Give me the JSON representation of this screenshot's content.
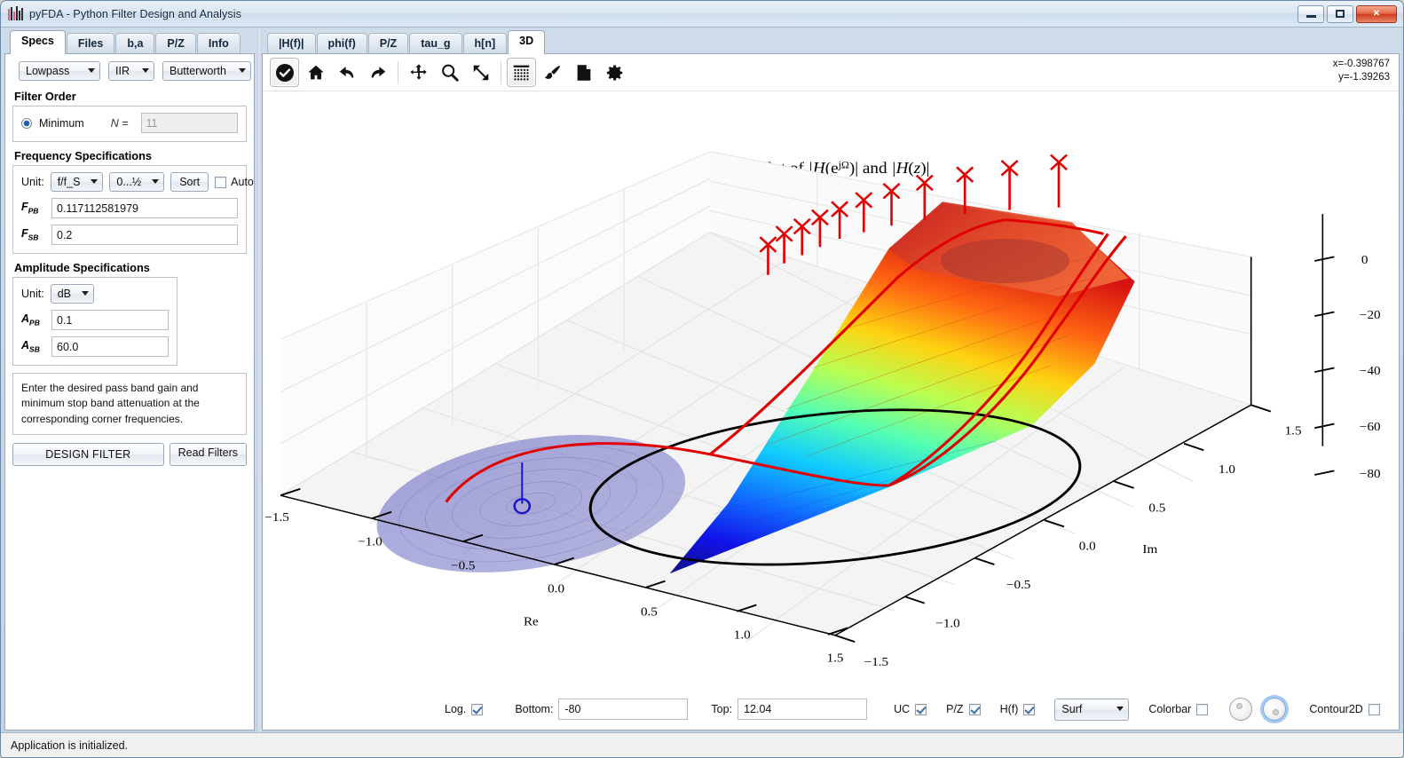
{
  "window": {
    "title": "pyFDA - Python Filter Design and Analysis",
    "buttons": {
      "minimize": "minimize-button",
      "maximize": "maximize-button",
      "close": "close-button"
    }
  },
  "left_tabs": [
    {
      "label": "Specs",
      "active": true
    },
    {
      "label": "Files",
      "active": false
    },
    {
      "label": "b,a",
      "active": false
    },
    {
      "label": "P/Z",
      "active": false
    },
    {
      "label": "Info",
      "active": false
    }
  ],
  "specs": {
    "response_type": "Lowpass",
    "filter_class": "IIR",
    "design_method": "Butterworth",
    "filter_order": {
      "title": "Filter Order",
      "mode_label": "Minimum",
      "n_label": "N =",
      "n_value": "11"
    },
    "frequency": {
      "title": "Frequency Specifications",
      "unit_label": "Unit:",
      "unit_value": "f/f_S",
      "range_value": "0...½",
      "sort_label": "Sort",
      "auto_label": "Auto",
      "auto_checked": false,
      "rows": [
        {
          "label": "F",
          "sub": "PB",
          "value": "0.117112581979"
        },
        {
          "label": "F",
          "sub": "SB",
          "value": "0.2"
        }
      ]
    },
    "amplitude": {
      "title": "Amplitude Specifications",
      "unit_label": "Unit:",
      "unit_value": "dB",
      "rows": [
        {
          "label": "A",
          "sub": "PB",
          "value": "0.1"
        },
        {
          "label": "A",
          "sub": "SB",
          "value": "60.0"
        }
      ]
    },
    "hint": "Enter the desired pass band gain and minimum stop band attenuation at the corresponding corner frequencies.",
    "design_filter_label": "DESIGN FILTER",
    "read_filters_label": "Read Filters"
  },
  "right_tabs": [
    {
      "label": "|H(f)|",
      "active": false
    },
    {
      "label": "phi(f)",
      "active": false
    },
    {
      "label": "P/Z",
      "active": false
    },
    {
      "label": "tau_g",
      "active": false
    },
    {
      "label": "h[n]",
      "active": false
    },
    {
      "label": "3D",
      "active": true
    }
  ],
  "plot_toolbar": {
    "icons": [
      {
        "name": "check-icon",
        "active": true
      },
      {
        "name": "home-icon",
        "active": false
      },
      {
        "name": "undo-icon",
        "active": false
      },
      {
        "name": "redo-icon",
        "active": false
      },
      {
        "name": "pan-icon",
        "active": false
      },
      {
        "name": "zoom-icon",
        "active": false
      },
      {
        "name": "resize-icon",
        "active": false
      },
      {
        "name": "grid-icon",
        "active": true
      },
      {
        "name": "brush-icon",
        "active": false
      },
      {
        "name": "save-icon",
        "active": false
      },
      {
        "name": "settings-icon",
        "active": false
      }
    ],
    "coord_x": "x=-0.398767",
    "coord_y": "y=-1.39263"
  },
  "plot_controls": {
    "log_label": "Log.",
    "log_checked": true,
    "bottom_label": "Bottom:",
    "bottom_value": "-80",
    "top_label": "Top:",
    "top_value": "12.04",
    "uc_label": "UC",
    "uc_checked": true,
    "pz_label": "P/Z",
    "pz_checked": true,
    "hf_label": "H(f)",
    "hf_checked": true,
    "mode_value": "Surf",
    "colorbar_label": "Colorbar",
    "colorbar_checked": false,
    "contour2d_label": "Contour2D",
    "contour2d_checked": false
  },
  "statusbar": {
    "message": "Application is initialized."
  },
  "chart_data": {
    "type": "surface",
    "title": "3D-Plot of |H(e^{jΩ})| and |H(z)|",
    "title_parts": {
      "prefix": "3D-Plot of ",
      "expr1": "|H(e",
      "expr1_sup": "jΩ",
      "expr1_end": ")|",
      "conj": " and ",
      "expr2": "|H(z)|"
    },
    "xlabel": "Re",
    "ylabel": "Im",
    "zlabel": "",
    "xticks": [
      "−1.5",
      "−1.0",
      "−0.5",
      "0.0",
      "0.5",
      "1.0",
      "1.5"
    ],
    "yticks": [
      "−1.5",
      "−1.0",
      "−0.5",
      "0.0",
      "0.5",
      "1.0",
      "1.5"
    ],
    "zticks": [
      "0",
      "−20",
      "−40",
      "−60",
      "−80"
    ],
    "xlim": [
      -1.5,
      1.5
    ],
    "ylim": [
      -1.5,
      1.5
    ],
    "zlim": [
      -80,
      12.04
    ],
    "colormap": "jet",
    "grid": true,
    "legend": "none",
    "annotations": [
      {
        "kind": "unit-circle",
        "color": "#000000"
      },
      {
        "kind": "frequency-response-curve",
        "color": "#e00000"
      },
      {
        "kind": "zeros",
        "marker": "x",
        "color": "#e00000",
        "count": 11
      },
      {
        "kind": "poles",
        "marker": "o",
        "color": "#1a18c8",
        "count": 1
      }
    ]
  }
}
